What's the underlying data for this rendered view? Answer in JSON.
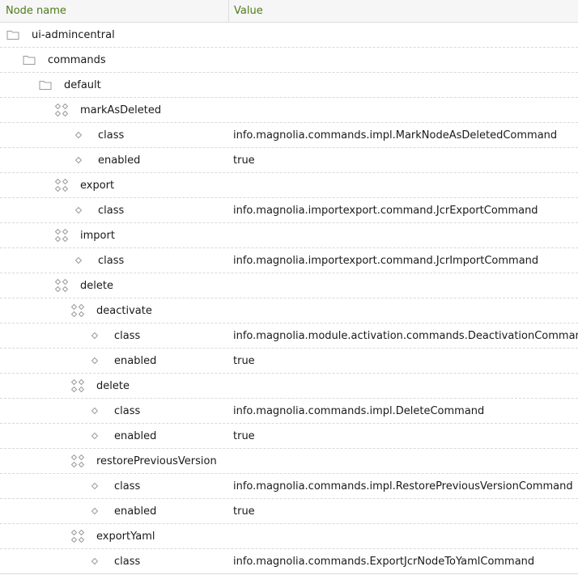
{
  "columns": {
    "name": "Node name",
    "value": "Value"
  },
  "rows": [
    {
      "name": "ui-admincentral",
      "value": "",
      "type": "folder",
      "level": 0
    },
    {
      "name": "commands",
      "value": "",
      "type": "folder",
      "level": 1
    },
    {
      "name": "default",
      "value": "",
      "type": "folder",
      "level": 2
    },
    {
      "name": "markAsDeleted",
      "value": "",
      "type": "content",
      "level": 3
    },
    {
      "name": "class",
      "value": "info.magnolia.commands.impl.MarkNodeAsDeletedCommand",
      "type": "property",
      "level": 4
    },
    {
      "name": "enabled",
      "value": "true",
      "type": "property",
      "level": 4
    },
    {
      "name": "export",
      "value": "",
      "type": "content",
      "level": 3
    },
    {
      "name": "class",
      "value": "info.magnolia.importexport.command.JcrExportCommand",
      "type": "property",
      "level": 4
    },
    {
      "name": "import",
      "value": "",
      "type": "content",
      "level": 3
    },
    {
      "name": "class",
      "value": "info.magnolia.importexport.command.JcrImportCommand",
      "type": "property",
      "level": 4
    },
    {
      "name": "delete",
      "value": "",
      "type": "content",
      "level": 3
    },
    {
      "name": "deactivate",
      "value": "",
      "type": "content",
      "level": 4
    },
    {
      "name": "class",
      "value": "info.magnolia.module.activation.commands.DeactivationCommand",
      "type": "property",
      "level": 5
    },
    {
      "name": "enabled",
      "value": "true",
      "type": "property",
      "level": 5
    },
    {
      "name": "delete",
      "value": "",
      "type": "content",
      "level": 4
    },
    {
      "name": "class",
      "value": "info.magnolia.commands.impl.DeleteCommand",
      "type": "property",
      "level": 5
    },
    {
      "name": "enabled",
      "value": "true",
      "type": "property",
      "level": 5
    },
    {
      "name": "restorePreviousVersion",
      "value": "",
      "type": "content",
      "level": 4
    },
    {
      "name": "class",
      "value": "info.magnolia.commands.impl.RestorePreviousVersionCommand",
      "type": "property",
      "level": 5
    },
    {
      "name": "enabled",
      "value": "true",
      "type": "property",
      "level": 5
    },
    {
      "name": "exportYaml",
      "value": "",
      "type": "content",
      "level": 4
    },
    {
      "name": "class",
      "value": "info.magnolia.commands.ExportJcrNodeToYamlCommand",
      "type": "property",
      "level": 5
    }
  ],
  "colors": {
    "header_text": "#4f7a19",
    "icon": "#9a9a9a",
    "separator": "#d9d9d9"
  },
  "icons": {
    "folder": "folder-icon",
    "content": "content-node-icon",
    "property": "property-icon"
  }
}
